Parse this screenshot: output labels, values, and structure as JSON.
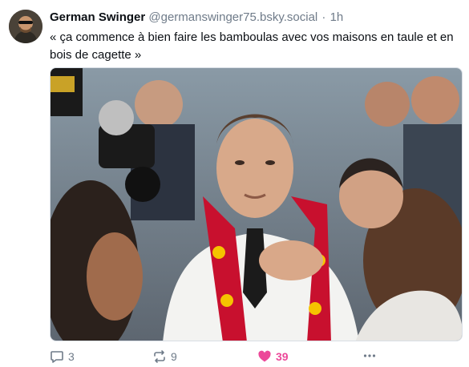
{
  "post": {
    "author": "German Swinger",
    "handle": "@germanswinger75.bsky.social",
    "separator": "·",
    "time": "1h",
    "text": "« ça commence à bien faire les  bamboulas avec vos maisons en taule et en bois de cagette »",
    "image_alt": ""
  },
  "actions": {
    "replies": "3",
    "reposts": "9",
    "likes": "39",
    "liked": true
  },
  "icons": {
    "reply": "reply-icon",
    "repost": "repost-icon",
    "like": "heart-icon",
    "more": "more-icon"
  },
  "colors": {
    "text": "#0b0f14",
    "muted": "#6f7b89",
    "like_accent": "#ec4899"
  }
}
